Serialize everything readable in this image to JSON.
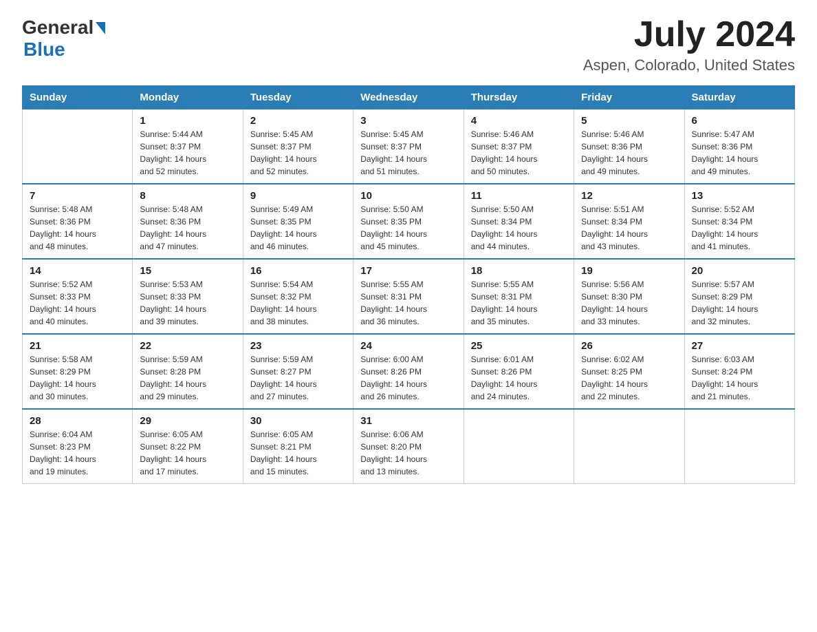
{
  "header": {
    "logo_general": "General",
    "logo_blue": "Blue",
    "month_year": "July 2024",
    "location": "Aspen, Colorado, United States"
  },
  "days_of_week": [
    "Sunday",
    "Monday",
    "Tuesday",
    "Wednesday",
    "Thursday",
    "Friday",
    "Saturday"
  ],
  "weeks": [
    [
      {
        "day": "",
        "info": ""
      },
      {
        "day": "1",
        "info": "Sunrise: 5:44 AM\nSunset: 8:37 PM\nDaylight: 14 hours\nand 52 minutes."
      },
      {
        "day": "2",
        "info": "Sunrise: 5:45 AM\nSunset: 8:37 PM\nDaylight: 14 hours\nand 52 minutes."
      },
      {
        "day": "3",
        "info": "Sunrise: 5:45 AM\nSunset: 8:37 PM\nDaylight: 14 hours\nand 51 minutes."
      },
      {
        "day": "4",
        "info": "Sunrise: 5:46 AM\nSunset: 8:37 PM\nDaylight: 14 hours\nand 50 minutes."
      },
      {
        "day": "5",
        "info": "Sunrise: 5:46 AM\nSunset: 8:36 PM\nDaylight: 14 hours\nand 49 minutes."
      },
      {
        "day": "6",
        "info": "Sunrise: 5:47 AM\nSunset: 8:36 PM\nDaylight: 14 hours\nand 49 minutes."
      }
    ],
    [
      {
        "day": "7",
        "info": "Sunrise: 5:48 AM\nSunset: 8:36 PM\nDaylight: 14 hours\nand 48 minutes."
      },
      {
        "day": "8",
        "info": "Sunrise: 5:48 AM\nSunset: 8:36 PM\nDaylight: 14 hours\nand 47 minutes."
      },
      {
        "day": "9",
        "info": "Sunrise: 5:49 AM\nSunset: 8:35 PM\nDaylight: 14 hours\nand 46 minutes."
      },
      {
        "day": "10",
        "info": "Sunrise: 5:50 AM\nSunset: 8:35 PM\nDaylight: 14 hours\nand 45 minutes."
      },
      {
        "day": "11",
        "info": "Sunrise: 5:50 AM\nSunset: 8:34 PM\nDaylight: 14 hours\nand 44 minutes."
      },
      {
        "day": "12",
        "info": "Sunrise: 5:51 AM\nSunset: 8:34 PM\nDaylight: 14 hours\nand 43 minutes."
      },
      {
        "day": "13",
        "info": "Sunrise: 5:52 AM\nSunset: 8:34 PM\nDaylight: 14 hours\nand 41 minutes."
      }
    ],
    [
      {
        "day": "14",
        "info": "Sunrise: 5:52 AM\nSunset: 8:33 PM\nDaylight: 14 hours\nand 40 minutes."
      },
      {
        "day": "15",
        "info": "Sunrise: 5:53 AM\nSunset: 8:33 PM\nDaylight: 14 hours\nand 39 minutes."
      },
      {
        "day": "16",
        "info": "Sunrise: 5:54 AM\nSunset: 8:32 PM\nDaylight: 14 hours\nand 38 minutes."
      },
      {
        "day": "17",
        "info": "Sunrise: 5:55 AM\nSunset: 8:31 PM\nDaylight: 14 hours\nand 36 minutes."
      },
      {
        "day": "18",
        "info": "Sunrise: 5:55 AM\nSunset: 8:31 PM\nDaylight: 14 hours\nand 35 minutes."
      },
      {
        "day": "19",
        "info": "Sunrise: 5:56 AM\nSunset: 8:30 PM\nDaylight: 14 hours\nand 33 minutes."
      },
      {
        "day": "20",
        "info": "Sunrise: 5:57 AM\nSunset: 8:29 PM\nDaylight: 14 hours\nand 32 minutes."
      }
    ],
    [
      {
        "day": "21",
        "info": "Sunrise: 5:58 AM\nSunset: 8:29 PM\nDaylight: 14 hours\nand 30 minutes."
      },
      {
        "day": "22",
        "info": "Sunrise: 5:59 AM\nSunset: 8:28 PM\nDaylight: 14 hours\nand 29 minutes."
      },
      {
        "day": "23",
        "info": "Sunrise: 5:59 AM\nSunset: 8:27 PM\nDaylight: 14 hours\nand 27 minutes."
      },
      {
        "day": "24",
        "info": "Sunrise: 6:00 AM\nSunset: 8:26 PM\nDaylight: 14 hours\nand 26 minutes."
      },
      {
        "day": "25",
        "info": "Sunrise: 6:01 AM\nSunset: 8:26 PM\nDaylight: 14 hours\nand 24 minutes."
      },
      {
        "day": "26",
        "info": "Sunrise: 6:02 AM\nSunset: 8:25 PM\nDaylight: 14 hours\nand 22 minutes."
      },
      {
        "day": "27",
        "info": "Sunrise: 6:03 AM\nSunset: 8:24 PM\nDaylight: 14 hours\nand 21 minutes."
      }
    ],
    [
      {
        "day": "28",
        "info": "Sunrise: 6:04 AM\nSunset: 8:23 PM\nDaylight: 14 hours\nand 19 minutes."
      },
      {
        "day": "29",
        "info": "Sunrise: 6:05 AM\nSunset: 8:22 PM\nDaylight: 14 hours\nand 17 minutes."
      },
      {
        "day": "30",
        "info": "Sunrise: 6:05 AM\nSunset: 8:21 PM\nDaylight: 14 hours\nand 15 minutes."
      },
      {
        "day": "31",
        "info": "Sunrise: 6:06 AM\nSunset: 8:20 PM\nDaylight: 14 hours\nand 13 minutes."
      },
      {
        "day": "",
        "info": ""
      },
      {
        "day": "",
        "info": ""
      },
      {
        "day": "",
        "info": ""
      }
    ]
  ]
}
